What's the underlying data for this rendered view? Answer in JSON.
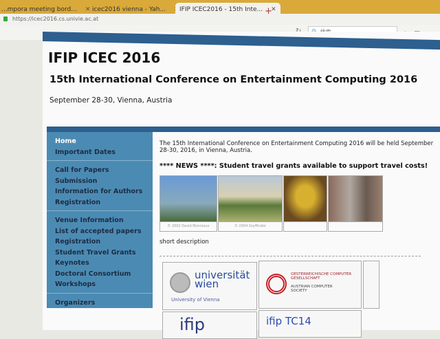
{
  "browser": {
    "tabs": [
      {
        "label": "...mpora meeting bord..."
      },
      {
        "label": "icec2016 vienna - Yah..."
      },
      {
        "label": "IFIP ICEC2016 - 15th Inte..."
      }
    ],
    "url": "https://icec2016.cs.univie.ac.at",
    "search_placeholder": "検索"
  },
  "header": {
    "title": "IFIP ICEC 2016",
    "subtitle": "15th International Conference on Entertainment Computing 2016",
    "date": "September 28-30, Vienna, Austria"
  },
  "sidebar": {
    "groups": [
      [
        "Home",
        "Important Dates"
      ],
      [
        "Call for Papers",
        "Submission",
        "Information for Authors",
        "Registration"
      ],
      [
        "Venue Information",
        "List of accepted papers",
        "Registration",
        "Student Travel Grants",
        "Keynotes",
        "Doctoral Consortium",
        "Workshops"
      ],
      [
        "Organizers"
      ]
    ]
  },
  "main": {
    "intro": "The 15th International Conference on Entertainment Computing 2016 will be held September 28-30, 2016, in Vienna, Austria.",
    "news": "**** NEWS ****: Student travel grants available to support travel costs!",
    "photos": [
      {
        "caption": "© 2002 David Monniaux"
      },
      {
        "caption": "© 2004 Gryffindor"
      },
      {
        "caption": ""
      },
      {
        "caption": ""
      }
    ],
    "short_description": "short description"
  },
  "logos": {
    "univie_name": "universität wien",
    "univie_sub": "University of Vienna",
    "ocg_de": "OESTERREICHISCHE COMPUTER GESELLSCHAFT",
    "ocg_en": "AUSTRIAN COMPUTER SOCIETY",
    "ifip": "ifip",
    "ifip_tc": "ifip TC14"
  }
}
